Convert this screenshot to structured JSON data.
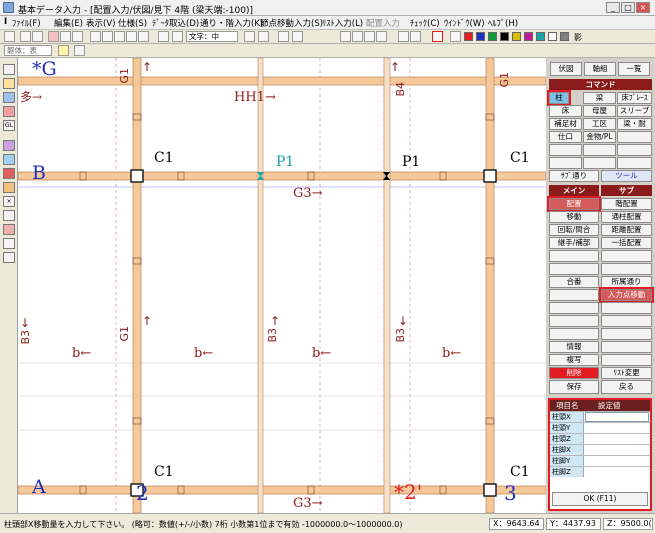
{
  "window": {
    "title": "基本データ入力 - [配置入力/伏図/見下 4階 (梁天端:-100)]",
    "minimize": "_",
    "maximize": "□",
    "close": "×"
  },
  "menu": [
    "ﾌｧｲﾙ(F)",
    "編集(E)",
    "表示(V)",
    "仕様(S)",
    "ﾃﾞｰﾀ取込(D)",
    "通り・階入力(K)",
    "節点移動入力(S)",
    "ﾘｽﾄ入力(L)",
    "配置入力",
    "ﾁｪｯｸ(C)",
    "ｳｲﾝﾄﾞｳ(W)",
    "ﾍﾙﾌﾟ(H)"
  ],
  "toolbar": {
    "font_label": "文字：中",
    "layer_label": "躯体：表",
    "shadow_label": "影"
  },
  "colors": {
    "beam": "#f5c89a",
    "axis_blue": "#1f2fbf",
    "accent_red": "#e31b23",
    "panel_head": "#8b1a1a",
    "cyan": "#1aa3a3"
  },
  "drawing": {
    "axis_star_g": "*G",
    "axis_b": "B",
    "axis_a": "A",
    "axis_2": "2",
    "axis_2prime": "*2'",
    "axis_3": "3",
    "c1": "C1",
    "p1": "P1",
    "g1": "G1",
    "g3": "G3→",
    "hh1": "HH1→",
    "b4": "B4",
    "b_arrow": "b←",
    "b3": "B3",
    "multi": "多→",
    "arrow_up": "↑",
    "arrow_down": "↓"
  },
  "panel": {
    "tabs": [
      "伏図",
      "軸組",
      "一覧"
    ],
    "command_head": "コマンド",
    "commands": [
      "柱",
      "梁",
      "床ﾌﾞﾚｰｽ",
      "床",
      "母屋",
      "スリーブ",
      "補足材",
      "工区",
      "梁・耐",
      "仕口",
      "金物/PL"
    ],
    "sub_passage": "ｻﾌﾞ通り",
    "tool": "ツール",
    "main_head": "メイン",
    "sub_head": "サブ",
    "main_items": [
      "配置",
      "移動",
      "回転/間合",
      "継手/補部",
      "",
      "",
      "合番",
      "",
      "",
      "",
      "",
      "情報",
      "複写",
      "削除"
    ],
    "sub_items": [
      "階配置",
      "通柱配置",
      "距離配置",
      "一括配置",
      "",
      "",
      "所属通り",
      "入力点移動",
      "",
      "",
      "",
      "",
      "",
      "ﾘｽﾄ変更"
    ],
    "save": "保存",
    "back": "戻る"
  },
  "settings": {
    "col_name": "項目名",
    "col_value": "設定値",
    "rows": [
      "柱頭X",
      "柱頭Y",
      "柱頭Z",
      "柱脚X",
      "柱脚Y",
      "柱脚Z"
    ],
    "ok": "OK (F11)"
  },
  "status": {
    "message": "柱頭部X移動量を入力して下さい。 (略可：数値(+/-/小数) 7桁 小数第1位まで有効 -1000000.0～1000000.0)",
    "x": "X：9643.64",
    "y": "Y：4437.93",
    "z": "Z：9500.0("
  }
}
